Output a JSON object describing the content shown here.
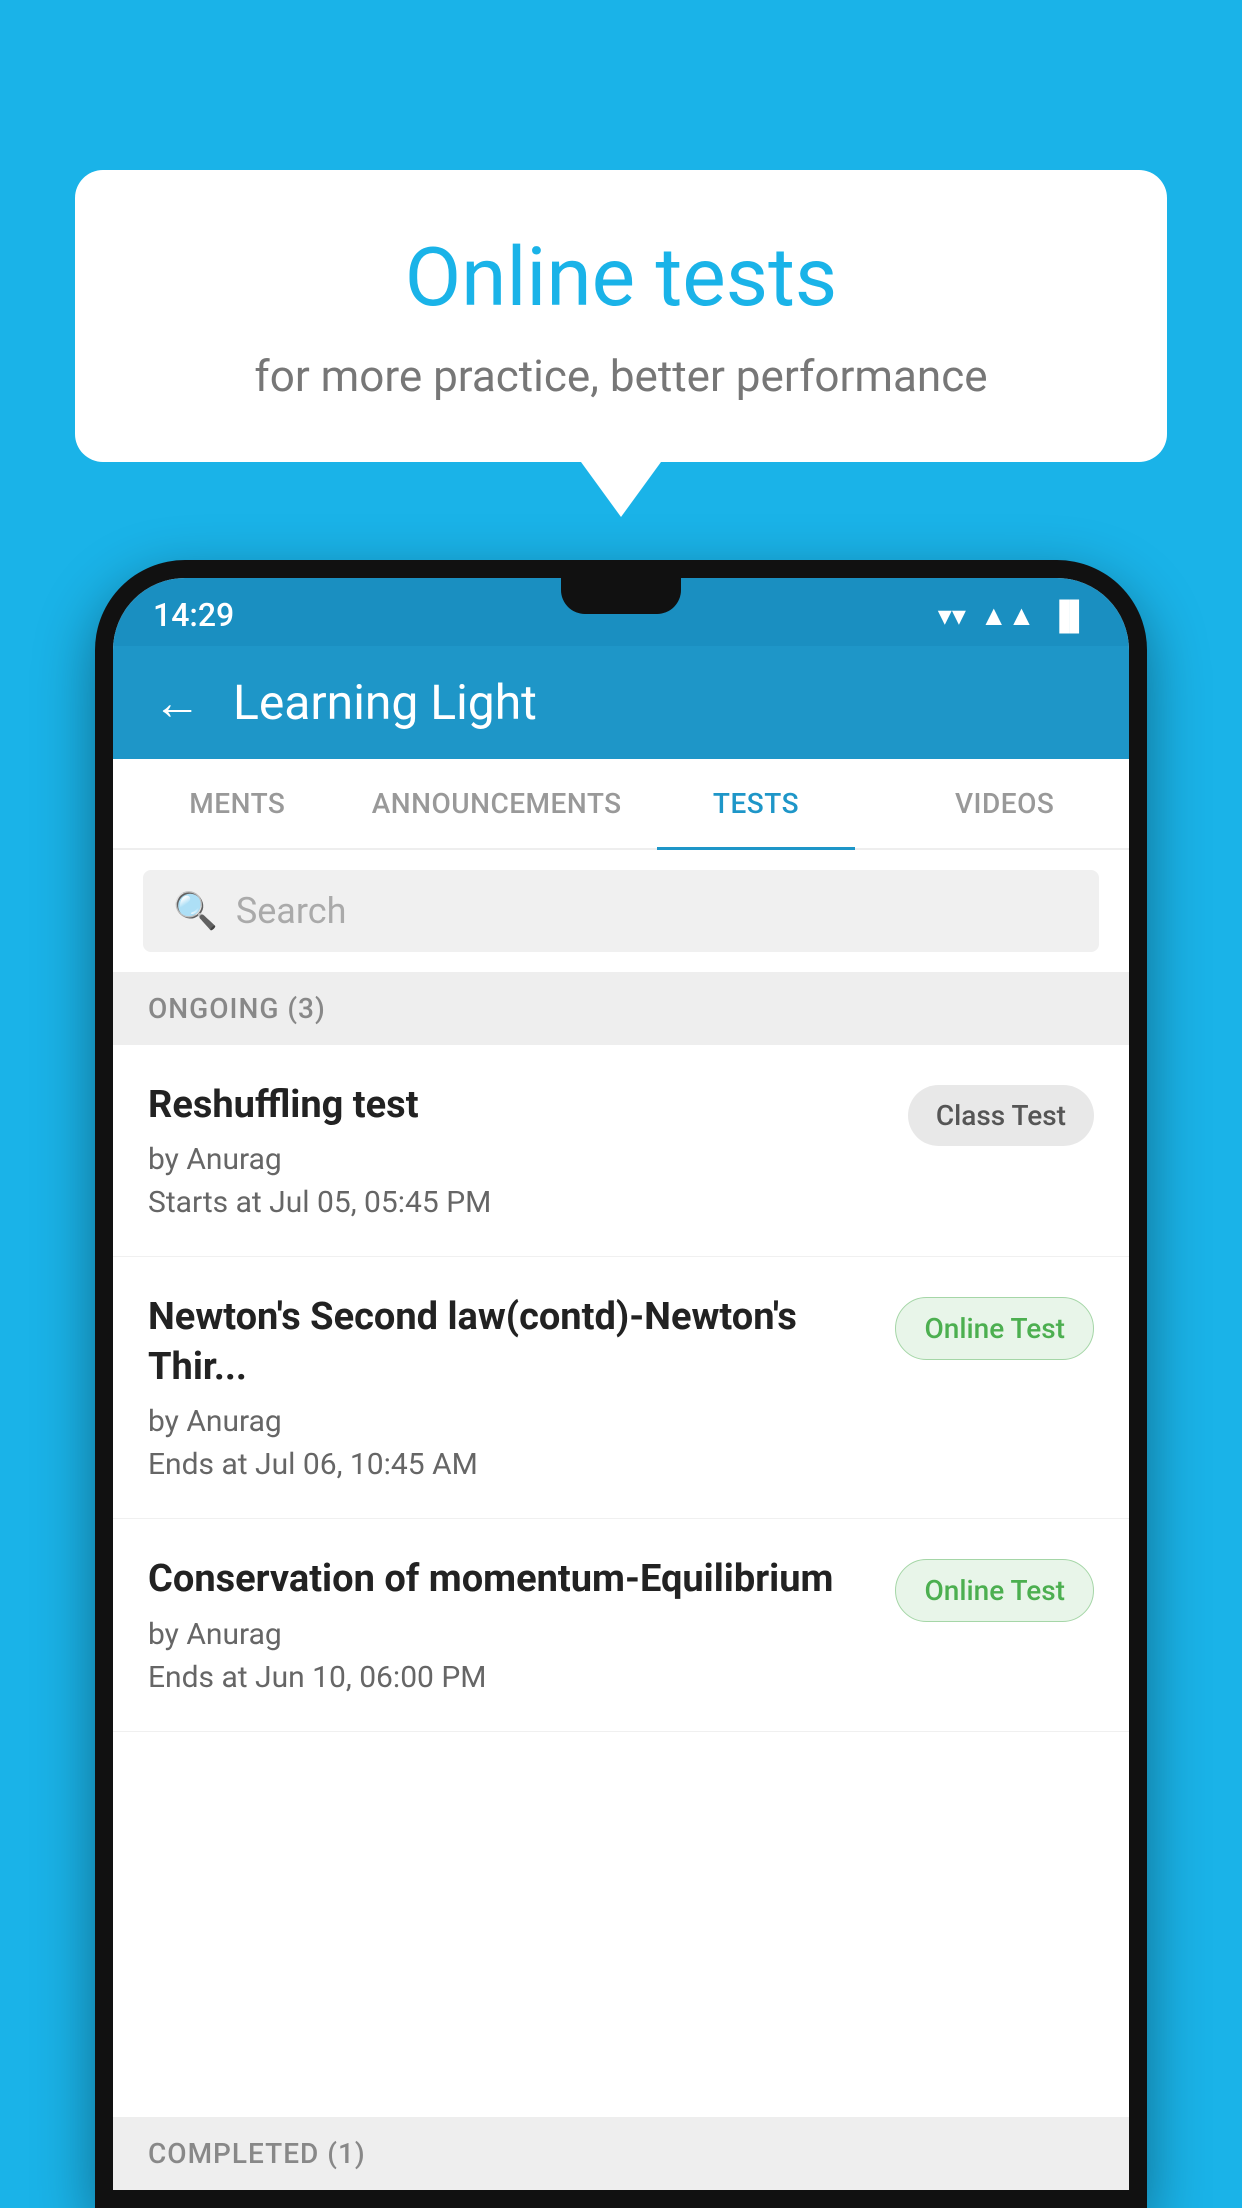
{
  "background_color": "#1ab3e8",
  "bubble": {
    "title": "Online tests",
    "subtitle": "for more practice, better performance"
  },
  "phone": {
    "status_bar": {
      "time": "14:29",
      "wifi": "▼",
      "signal": "▲",
      "battery": "▐"
    },
    "app_bar": {
      "back_label": "←",
      "title": "Learning Light"
    },
    "tabs": [
      {
        "label": "MENTS",
        "active": false
      },
      {
        "label": "ANNOUNCEMENTS",
        "active": false
      },
      {
        "label": "TESTS",
        "active": true
      },
      {
        "label": "VIDEOS",
        "active": false
      }
    ],
    "search": {
      "placeholder": "Search"
    },
    "ongoing_section": {
      "label": "ONGOING (3)"
    },
    "tests": [
      {
        "name": "Reshuffling test",
        "author": "by Anurag",
        "date": "Starts at  Jul 05, 05:45 PM",
        "badge": "Class Test",
        "badge_type": "class"
      },
      {
        "name": "Newton's Second law(contd)-Newton's Thir...",
        "author": "by Anurag",
        "date": "Ends at  Jul 06, 10:45 AM",
        "badge": "Online Test",
        "badge_type": "online"
      },
      {
        "name": "Conservation of momentum-Equilibrium",
        "author": "by Anurag",
        "date": "Ends at  Jun 10, 06:00 PM",
        "badge": "Online Test",
        "badge_type": "online"
      }
    ],
    "completed_section": {
      "label": "COMPLETED (1)"
    }
  }
}
